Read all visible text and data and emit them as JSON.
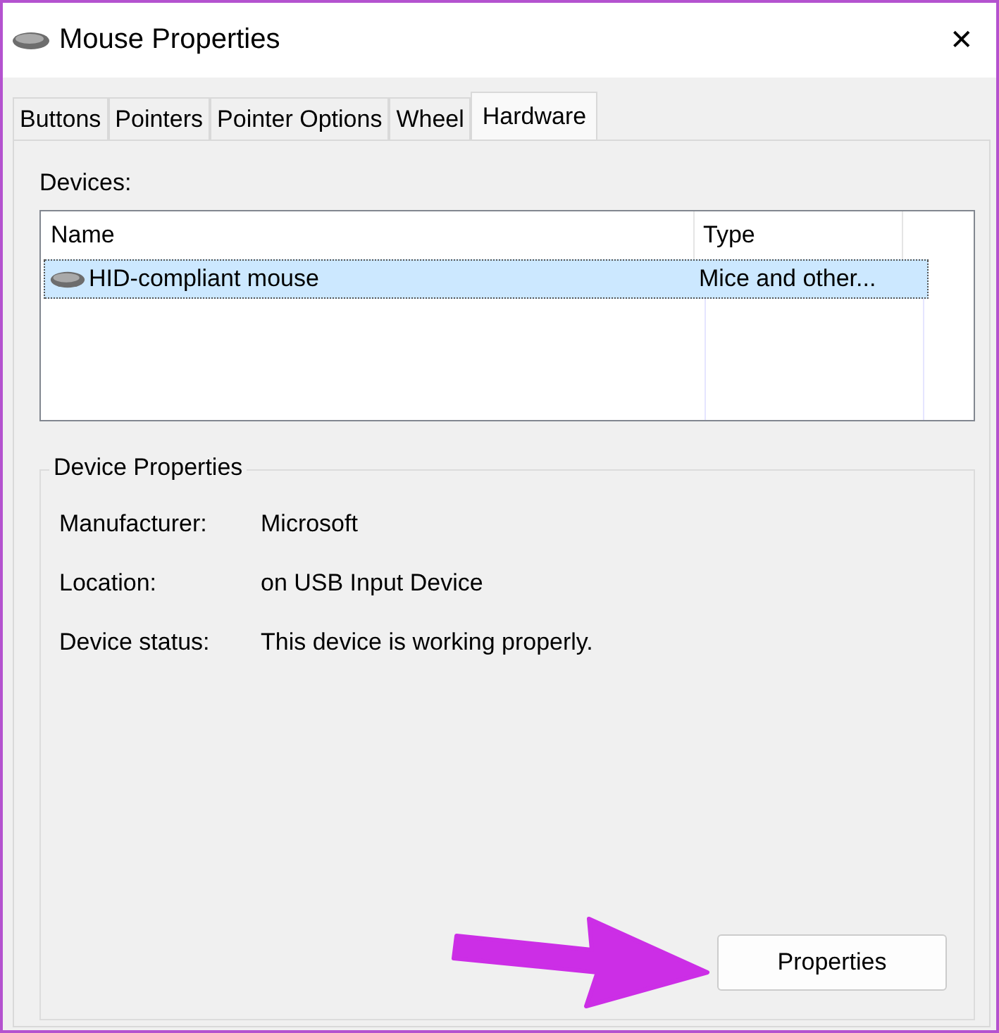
{
  "window": {
    "title": "Mouse Properties",
    "close": "✕"
  },
  "tabs": [
    {
      "label": "Buttons",
      "selected": false
    },
    {
      "label": "Pointers",
      "selected": false
    },
    {
      "label": "Pointer Options",
      "selected": false
    },
    {
      "label": "Wheel",
      "selected": false
    },
    {
      "label": "Hardware",
      "selected": true
    }
  ],
  "devices": {
    "label": "Devices:",
    "columns": [
      "Name",
      "Type"
    ],
    "rows": [
      {
        "name": "HID-compliant mouse",
        "type": "Mice and other...",
        "selected": true
      }
    ]
  },
  "device_properties": {
    "title": "Device Properties",
    "fields": [
      {
        "label": "Manufacturer:",
        "value": "Microsoft"
      },
      {
        "label": "Location:",
        "value": "on USB Input Device"
      },
      {
        "label": "Device status:",
        "value": "This device is working properly."
      }
    ]
  },
  "buttons": [
    "Properties"
  ]
}
